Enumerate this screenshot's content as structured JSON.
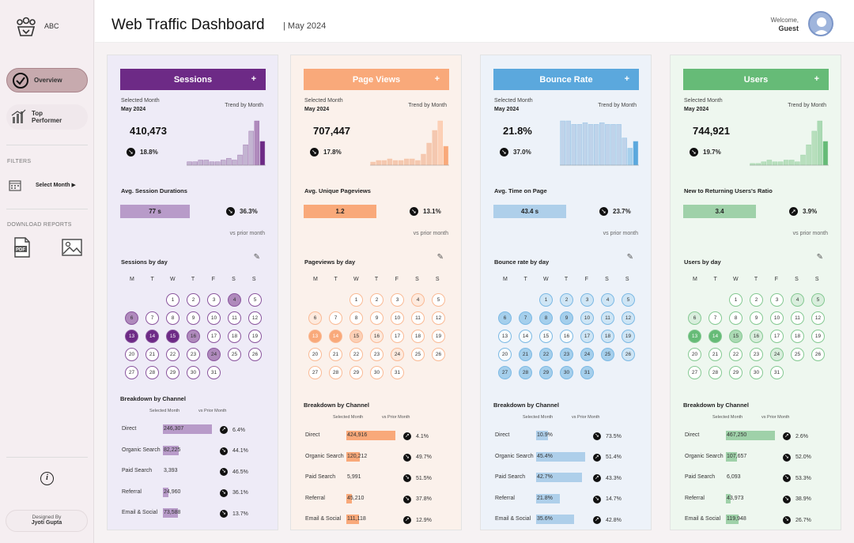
{
  "sidebar": {
    "brand": "ABC",
    "overview": "Overview",
    "top_performer": "Top Performer",
    "filters_label": "FILTERS",
    "select_month": "Select Month ▶",
    "download_label": "DOWNLOAD REPORTS",
    "designed_by": "Designed By",
    "designer": "Jyoti Gupta",
    "colors": {
      "overview_bg": "#c7aaae",
      "overview_border": "#a9848b"
    }
  },
  "header": {
    "title": "Web Traffic Dashboard",
    "subtitle": "| May 2024",
    "welcome": "Welcome,",
    "user": "Guest"
  },
  "panels": [
    {
      "key": "sessions",
      "title": "Sessions",
      "plus": "+",
      "color": "#6d2a86",
      "bar_light": "#c3b4d1",
      "bg": "#eeebf7",
      "selected_month_label": "Selected Month",
      "month": "May 2024",
      "trend_label": "Trend by Month",
      "value": "410,473",
      "change": "18.8%",
      "change_dir": "down",
      "spark": [
        2,
        2,
        3,
        3,
        2,
        2,
        3,
        4,
        3,
        6,
        12,
        20,
        26,
        14
      ],
      "kpi_title": "Avg. Session Durations",
      "kpi_value": "77 s",
      "kpi_fill": 0.48,
      "kpi_color": "#b89bc9",
      "kpi_change": "36.3%",
      "kpi_dir": "down",
      "vs": "vs prior month",
      "cal_title": "Sessions by day",
      "highlight": {
        "13": "dark",
        "14": "dark",
        "15": "dark",
        "16": "mid",
        "24": "mid",
        "4": "mid",
        "6": "mid"
      },
      "bd_title": "Breakdown by Channel",
      "bd_sel": "Selected Month",
      "bd_vs": "vs Prior Month",
      "rows": [
        {
          "name": "Direct",
          "value": "246,307",
          "fill": 1.0,
          "pct": "6.4%",
          "dir": "up"
        },
        {
          "name": "Organic Search",
          "value": "82,225",
          "fill": 0.33,
          "pct": "44.1%",
          "dir": "down"
        },
        {
          "name": "Paid Search",
          "value": "3,393",
          "fill": 0.0,
          "pct": "46.5%",
          "dir": "down"
        },
        {
          "name": "Referral",
          "value": "24,960",
          "fill": 0.12,
          "pct": "36.1%",
          "dir": "down"
        },
        {
          "name": "Email & Social",
          "value": "73,588",
          "fill": 0.3,
          "pct": "13.7%",
          "dir": "down"
        }
      ]
    },
    {
      "key": "pageviews",
      "title": "Page Views",
      "plus": "+",
      "color": "#f9a97a",
      "bar_light": "#f4c8b0",
      "bg": "#fbf1eb",
      "selected_month_label": "Selected Month",
      "month": "May 2024",
      "trend_label": "Trend by Month",
      "value": "707,447",
      "change": "17.8%",
      "change_dir": "down",
      "spark": [
        2,
        3,
        3,
        4,
        3,
        3,
        4,
        4,
        3,
        7,
        14,
        22,
        28,
        12
      ],
      "kpi_title": "Avg. Unique Pageviews",
      "kpi_value": "1.2",
      "kpi_fill": 0.5,
      "kpi_color": "#f9a97a",
      "kpi_change": "13.1%",
      "kpi_dir": "down",
      "vs": "vs prior month",
      "cal_title": "Pageviews by day",
      "highlight": {
        "13": "dark",
        "14": "dark",
        "15": "mid",
        "16": "light",
        "24": "light",
        "4": "light",
        "6": "light"
      },
      "bd_title": "Breakdown by Channel",
      "bd_sel": "Selected Month",
      "bd_vs": "vs Prior Month",
      "rows": [
        {
          "name": "Direct",
          "value": "424,916",
          "fill": 1.0,
          "pct": "4.1%",
          "dir": "up"
        },
        {
          "name": "Organic Search",
          "value": "120,212",
          "fill": 0.28,
          "pct": "49.7%",
          "dir": "down"
        },
        {
          "name": "Paid Search",
          "value": "5,991",
          "fill": 0.0,
          "pct": "51.5%",
          "dir": "down"
        },
        {
          "name": "Referral",
          "value": "45,210",
          "fill": 0.11,
          "pct": "37.8%",
          "dir": "down"
        },
        {
          "name": "Email & Social",
          "value": "111,118",
          "fill": 0.26,
          "pct": "12.9%",
          "dir": "up"
        }
      ]
    },
    {
      "key": "bouncerate",
      "title": "Bounce Rate",
      "plus": "+",
      "color": "#5ba8dd",
      "bar_light": "#bfd3ea",
      "bg": "#edf2f9",
      "selected_month_label": "Selected Month",
      "month": "May 2024",
      "trend_label": "Trend by Month",
      "value": "21.8%",
      "change": "37.0%",
      "change_dir": "down",
      "spark": [
        26,
        26,
        24,
        24,
        25,
        24,
        24,
        25,
        24,
        24,
        24,
        16,
        10,
        14
      ],
      "kpi_title": "Avg. Time on Page",
      "kpi_value": "43.4 s",
      "kpi_fill": 0.5,
      "kpi_color": "#aecfea",
      "kpi_change": "23.7%",
      "kpi_dir": "down",
      "vs": "vs prior month",
      "cal_title": "Bounce rate by day",
      "highlight": {
        "all": "blue"
      },
      "bd_title": "Breakdown by Channel",
      "bd_sel": "Selected Month",
      "bd_vs": "vs Prior Month",
      "rows": [
        {
          "name": "Direct",
          "value": "10.9%",
          "fill": 0.24,
          "pct": "73.5%",
          "dir": "down"
        },
        {
          "name": "Organic Search",
          "value": "45.4%",
          "fill": 1.0,
          "pct": "51.4%",
          "dir": "up"
        },
        {
          "name": "Paid Search",
          "value": "42.7%",
          "fill": 0.94,
          "pct": "43.3%",
          "dir": "up"
        },
        {
          "name": "Referral",
          "value": "21.8%",
          "fill": 0.48,
          "pct": "14.7%",
          "dir": "down"
        },
        {
          "name": "Email & Social",
          "value": "35.6%",
          "fill": 0.78,
          "pct": "42.8%",
          "dir": "up"
        }
      ]
    },
    {
      "key": "users",
      "title": "Users",
      "plus": "+",
      "color": "#66bb77",
      "bar_light": "#b8dfbd",
      "bg": "#eef7ef",
      "selected_month_label": "Selected Month",
      "month": "May 2024",
      "trend_label": "Trend by Month",
      "value": "744,921",
      "change": "19.7%",
      "change_dir": "down",
      "spark": [
        1,
        1,
        2,
        3,
        2,
        2,
        3,
        3,
        2,
        6,
        12,
        20,
        26,
        14
      ],
      "kpi_title": "New to Returning Users's Ratio",
      "kpi_value": "3.4",
      "kpi_fill": 0.5,
      "kpi_color": "#9fd1a9",
      "kpi_change": "3.9%",
      "kpi_dir": "up",
      "vs": "vs prior month",
      "cal_title": "Users by day",
      "highlight": {
        "13": "dark",
        "14": "dark",
        "15": "mid",
        "16": "light",
        "24": "light",
        "4": "light",
        "6": "light",
        "5": "light"
      },
      "bd_title": "Breakdown by Channel",
      "bd_sel": "Selected Month",
      "bd_vs": "vs Prior Month",
      "rows": [
        {
          "name": "Direct",
          "value": "467,250",
          "fill": 1.0,
          "pct": "2.6%",
          "dir": "up"
        },
        {
          "name": "Organic Search",
          "value": "107,657",
          "fill": 0.23,
          "pct": "52.0%",
          "dir": "down"
        },
        {
          "name": "Paid Search",
          "value": "6,093",
          "fill": 0.0,
          "pct": "53.3%",
          "dir": "down"
        },
        {
          "name": "Referral",
          "value": "43,973",
          "fill": 0.09,
          "pct": "38.9%",
          "dir": "down"
        },
        {
          "name": "Email & Social",
          "value": "119,948",
          "fill": 0.26,
          "pct": "26.7%",
          "dir": "down"
        }
      ]
    }
  ],
  "calendar": {
    "dow": [
      "M",
      "T",
      "W",
      "T",
      "F",
      "S",
      "S"
    ]
  }
}
